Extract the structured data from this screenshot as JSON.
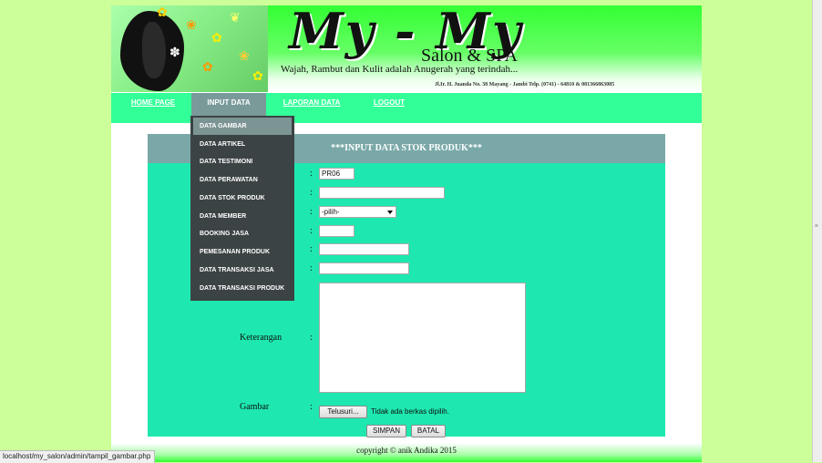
{
  "header": {
    "title": "My - My",
    "subtitle": "Salon & SPA",
    "tagline": "Wajah, Rambut dan Kulit adalah Anugerah yang terindah...",
    "address": "Jl.Ir. H. Juanda No. 38 Mayang - Jambi   Telp. (0741) - 64810 & 081366863085"
  },
  "nav": {
    "home": "HOME PAGE",
    "input": "INPUT DATA",
    "laporan": "LAPORAN DATA",
    "logout": "LOGOUT"
  },
  "dropdown": {
    "items": [
      "DATA GAMBAR",
      "DATA ARTIKEL",
      "DATA TESTIMONI",
      "DATA PERAWATAN",
      "DATA STOK PRODUK",
      "DATA MEMBER",
      "BOOKING JASA",
      "PEMESANAN PRODUK",
      "DATA TRANSAKSI JASA",
      "DATA TRANSAKSI PRODUK"
    ]
  },
  "form": {
    "title": "***INPUT DATA STOK PRODUK***",
    "colon": ":",
    "kode_value": "PR06",
    "select_value": "-pilih-",
    "keterangan_label": "Keterangan",
    "gambar_label": "Gambar",
    "browse_label": "Telusuri...",
    "file_status": "Tidak ada berkas dipilih.",
    "submit_label": "SIMPAN",
    "cancel_label": "BATAL"
  },
  "footer": {
    "copyright": "copyright © anik Andika 2015"
  },
  "browser": {
    "status_url": "localhost/my_salon/admin/tampil_gambar.php"
  },
  "colors": {
    "page_bg": "#ccff99",
    "navbar": "#33ff99",
    "form_panel": "#1ee8b0",
    "title_bar": "#7aa8a8",
    "dropdown": "#3c4344"
  }
}
